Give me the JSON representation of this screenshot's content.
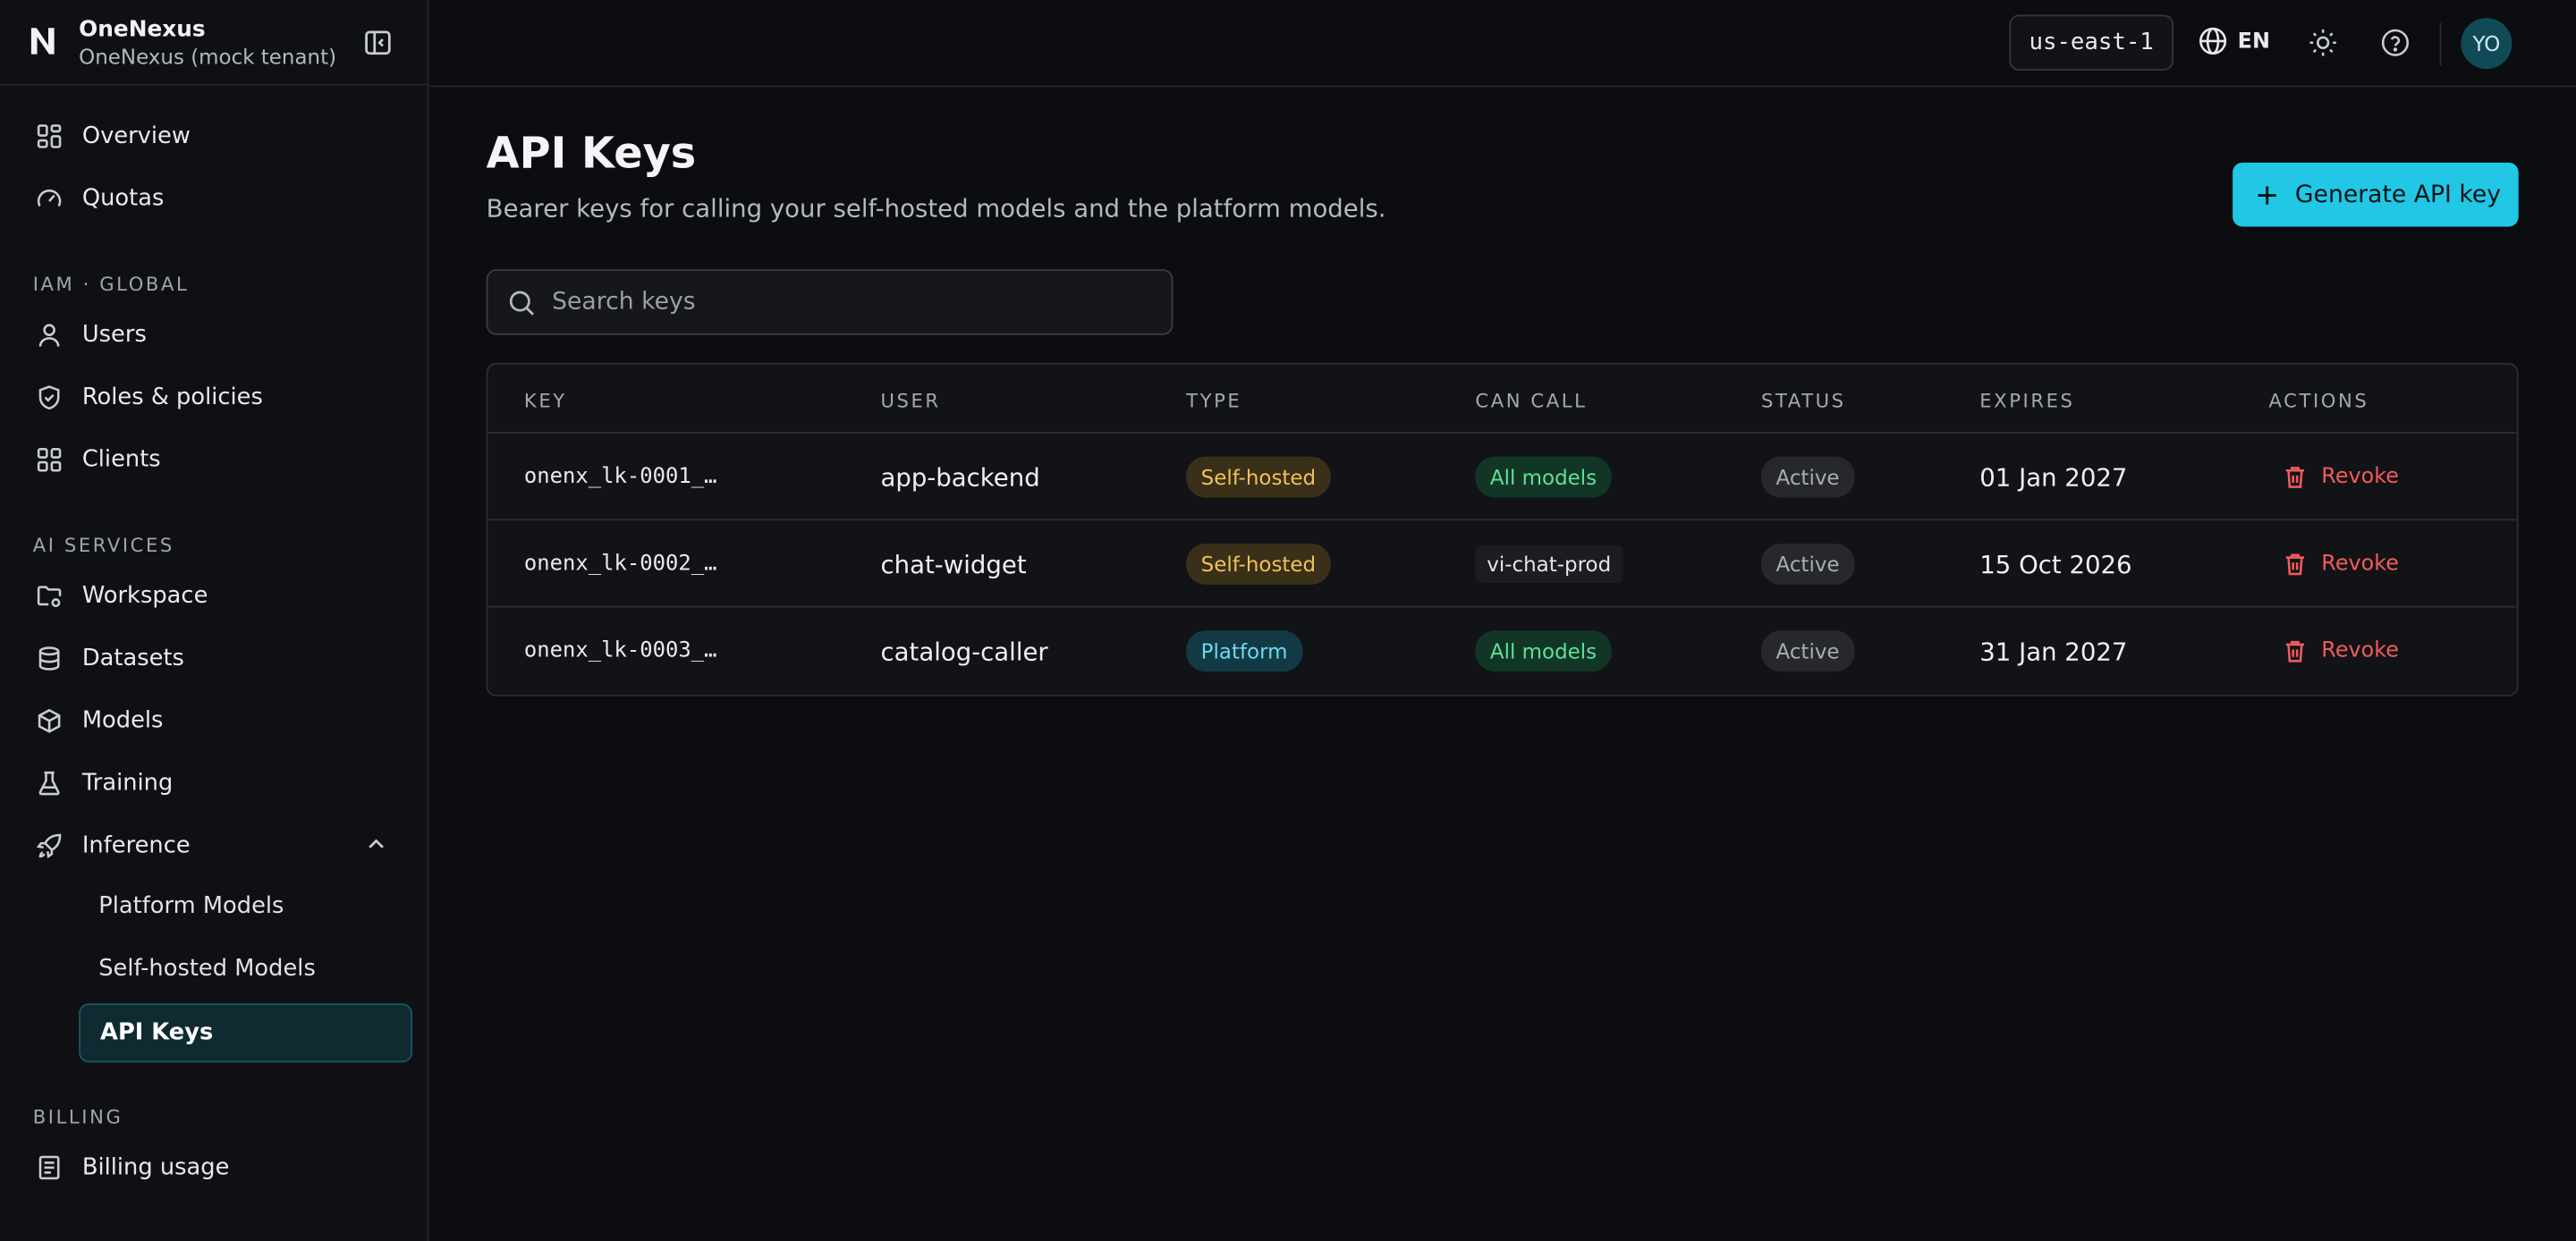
{
  "brand": {
    "name": "OneNexus",
    "tenant": "OneNexus (mock tenant)"
  },
  "sidebar": {
    "top_items": [
      {
        "label": "Overview",
        "icon": "grid-icon"
      },
      {
        "label": "Quotas",
        "icon": "gauge-icon"
      }
    ],
    "iam_section": "IAM · GLOBAL",
    "iam_items": [
      {
        "label": "Users",
        "icon": "user-icon"
      },
      {
        "label": "Roles & policies",
        "icon": "shield-icon"
      },
      {
        "label": "Clients",
        "icon": "grid-icon"
      }
    ],
    "ai_section": "AI SERVICES",
    "ai_items": [
      {
        "label": "Workspace",
        "icon": "folder-gear-icon"
      },
      {
        "label": "Datasets",
        "icon": "database-icon"
      },
      {
        "label": "Models",
        "icon": "cube-icon"
      },
      {
        "label": "Training",
        "icon": "flask-icon"
      },
      {
        "label": "Inference",
        "icon": "rocket-icon"
      }
    ],
    "inference_sub": [
      {
        "label": "Platform Models"
      },
      {
        "label": "Self-hosted Models"
      },
      {
        "label": "API Keys",
        "active": true
      }
    ],
    "billing_section": "BILLING",
    "billing_items": [
      {
        "label": "Billing usage",
        "icon": "receipt-icon"
      }
    ]
  },
  "topbar": {
    "region": "us-east-1",
    "language": "EN",
    "avatar_initials": "YO"
  },
  "page": {
    "title": "API Keys",
    "subtitle": "Bearer keys for calling your self-hosted models and the platform models.",
    "generate_button": "Generate API key",
    "search_placeholder": "Search keys"
  },
  "table": {
    "headers": [
      "KEY",
      "USER",
      "TYPE",
      "CAN CALL",
      "STATUS",
      "EXPIRES",
      "ACTIONS"
    ],
    "rows": [
      {
        "key": "onenx_lk-0001_…",
        "user": "app-backend",
        "type": "Self-hosted",
        "can_call": "All models",
        "status": "Active",
        "expires": "01 Jan 2027",
        "action": "Revoke"
      },
      {
        "key": "onenx_lk-0002_…",
        "user": "chat-widget",
        "type": "Self-hosted",
        "can_call": "vi-chat-prod",
        "status": "Active",
        "expires": "15 Oct 2026",
        "action": "Revoke"
      },
      {
        "key": "onenx_lk-0003_…",
        "user": "catalog-caller",
        "type": "Platform",
        "can_call": "All models",
        "status": "Active",
        "expires": "31 Jan 2027",
        "action": "Revoke"
      }
    ]
  },
  "colors": {
    "accent": "#21c7e5",
    "danger": "#ef5b5b",
    "self_hosted": "#f0c15a",
    "platform": "#6fd8ee",
    "all_models": "#5fe09a"
  }
}
